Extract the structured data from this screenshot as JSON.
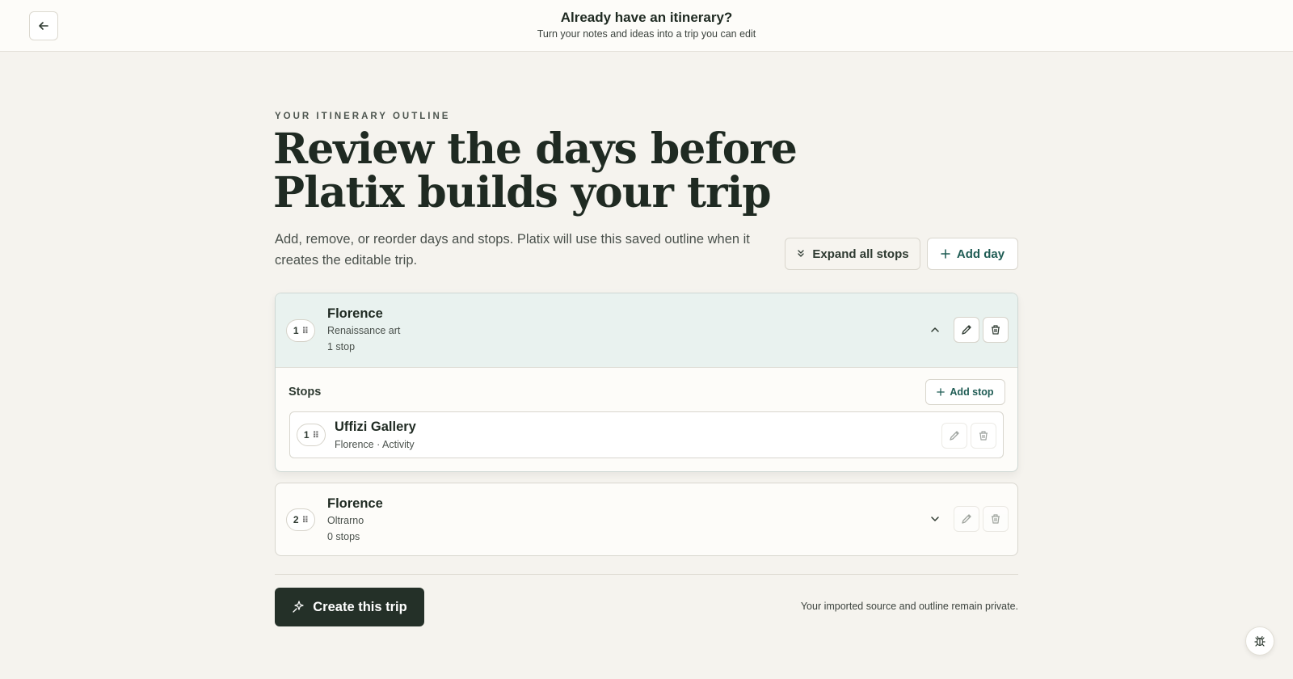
{
  "header": {
    "title": "Already have an itinerary?",
    "subtitle": "Turn your notes and ideas into a trip you can edit"
  },
  "outline": {
    "eyebrow": "YOUR ITINERARY OUTLINE",
    "headline_line1": "Review the days before",
    "headline_line2": "Platix builds your trip",
    "intro": "Add, remove, or reorder days and stops. Platix will use this saved outline when it creates the editable trip.",
    "expand_label": "Expand all stops",
    "add_day_label": "Add day"
  },
  "days": [
    {
      "number": "1",
      "title": "Florence",
      "subtitle": "Renaissance art",
      "count": "1 stop",
      "stops_label": "Stops",
      "add_stop_label": "Add stop",
      "stops": [
        {
          "number": "1",
          "title": "Uffizi Gallery",
          "subtitle": "Florence · Activity"
        }
      ]
    },
    {
      "number": "2",
      "title": "Florence",
      "subtitle": "Oltrarno",
      "count": "0 stops"
    }
  ],
  "footer": {
    "create_label": "Create this trip",
    "privacy": "Your imported source and outline remain private."
  },
  "icons": {
    "back": "arrow-left-icon",
    "expand": "chevrons-down-icon",
    "add": "plus-icon",
    "drag": "drag-handle-icon",
    "collapse": "chevron-up-icon",
    "expand_day": "chevron-down-icon",
    "edit": "pencil-icon",
    "delete": "trash-icon",
    "sparkle": "sparkle-icon",
    "bug": "bug-icon"
  },
  "colors": {
    "accent": "#1f5c54",
    "primary_button": "#243028",
    "expanded_header": "#e9f2ef",
    "background": "#f5f3ee"
  }
}
